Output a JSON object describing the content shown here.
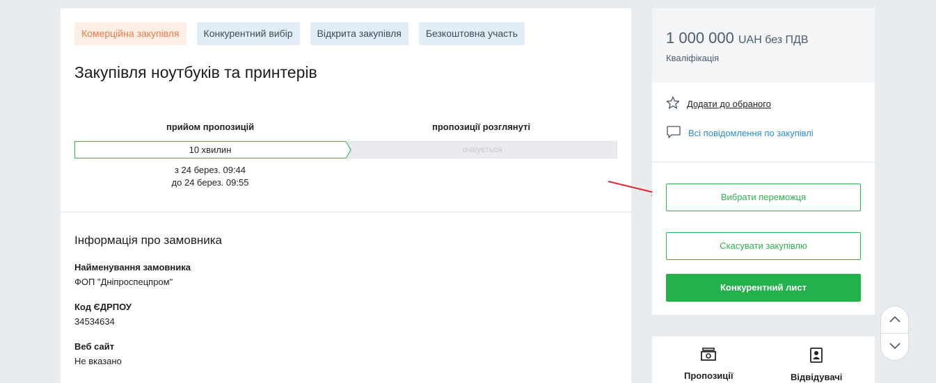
{
  "tags": [
    "Комерційна закупівля",
    "Конкурентний вибір",
    "Відкрита закупівля",
    "Безкоштовна участь"
  ],
  "title": "Закупівля ноутбуків та принтерів",
  "stages": {
    "stage1_label": "прийом пропозицій",
    "stage2_label": "пропозиції розглянуті",
    "stage1_bar": "10 хвилин",
    "stage2_bar": "очікується",
    "date_from": "з 24 берез. 09:44",
    "date_to": "до 24 берез. 09:55"
  },
  "customer": {
    "section_title": "Інформація про замовника",
    "name_label": "Найменування замовника",
    "name_value": "ФОП \"Дніпроспецпром\"",
    "code_label": "Код ЄДРПОУ",
    "code_value": "34534634",
    "site_label": "Веб сайт",
    "site_value": "Не вказано"
  },
  "sidebar": {
    "price": "1 000 000",
    "price_unit": "UAH без ПДВ",
    "qualification": "Кваліфікація",
    "favorite_link": "Додати до обраного",
    "messages_link": "Всі повідомлення по закупівлі",
    "choose_winner": "Вибрати переможця",
    "cancel_tender": "Скасувати закупівлю",
    "competitive_sheet": "Конкурентний лист"
  },
  "bottom_tabs": {
    "proposals": "Пропозиції",
    "visitors": "Відвідувачі"
  },
  "icons": {
    "star": "star-icon",
    "message": "message-icon",
    "money": "money-icon",
    "visitor": "visitor-icon",
    "up": "chevron-up-icon",
    "down": "chevron-down-icon"
  },
  "colors": {
    "accent_green": "#22b14c",
    "commercial_tag": "#ee7a45",
    "link_blue": "#2a8ecf",
    "annotation_red": "#e8202a"
  }
}
